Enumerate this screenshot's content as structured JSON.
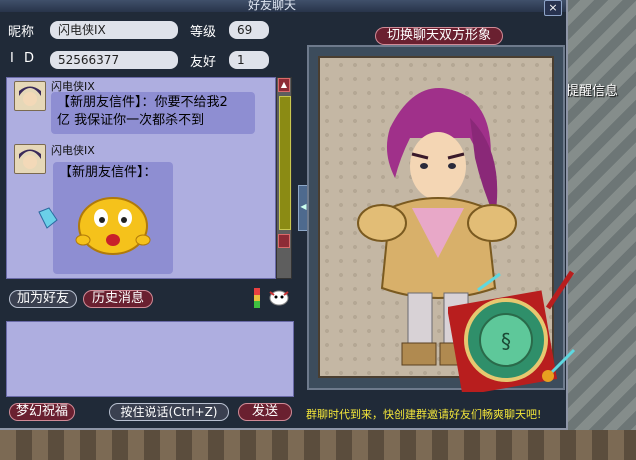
{
  "window": {
    "title": "好友聊天",
    "close": "×"
  },
  "profile": {
    "nickname_label": "昵称",
    "nickname": "闪电侠IX",
    "level_label": "等级",
    "level": "69",
    "id_label": "I D",
    "id": "52566377",
    "friendship_label": "友好",
    "friendship": "1"
  },
  "messages": [
    {
      "sender": "闪电侠IX",
      "text_line1": "【新朋友信件】：你要不给我2",
      "text_line2": "亿 我保证你一次都杀不到"
    },
    {
      "sender": "闪电侠IX",
      "text": "【新朋友信件】："
    }
  ],
  "buttons": {
    "switch_portrait": "切换聊天双方形象",
    "add_friend": "加为好友",
    "history": "历史消息",
    "dream_wish": "梦幻祝福",
    "push_to_talk": "按住说话(Ctrl+Z)",
    "send": "发送"
  },
  "footer": {
    "slogan": "群聊时代到来，快创建群邀请好友们畅爽聊天吧!"
  },
  "background": {
    "reminder": "提醒信息"
  }
}
